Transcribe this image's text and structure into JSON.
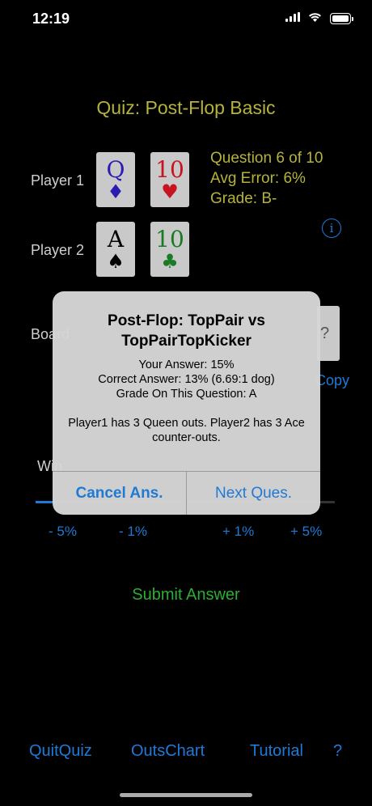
{
  "status_bar": {
    "time": "12:19"
  },
  "title": "Quiz: Post-Flop Basic",
  "players": [
    {
      "label": "Player 1",
      "cards": [
        {
          "rank": "Q",
          "suit": "♦",
          "color": "#2a1bb3"
        },
        {
          "rank": "10",
          "suit": "♥",
          "color": "#c8141e"
        }
      ]
    },
    {
      "label": "Player 2",
      "cards": [
        {
          "rank": "A",
          "suit": "♠",
          "color": "#000000"
        },
        {
          "rank": "10",
          "suit": "♣",
          "color": "#1a7a25"
        }
      ]
    }
  ],
  "info": {
    "question": "Question 6 of 10",
    "avg_error": "Avg Error: 6%",
    "grade": "Grade: B-"
  },
  "info_icon": "i",
  "board": {
    "label": "Board",
    "card_hint": "?",
    "copy_link": "Copy"
  },
  "win_label": "Win",
  "adjust_buttons": [
    "- 5%",
    "- 1%",
    "+ 1%",
    "+ 5%"
  ],
  "submit_label": "Submit Answer",
  "bottom_nav": [
    "QuitQuiz",
    "OutsChart",
    "Tutorial",
    "?"
  ],
  "alert": {
    "title": "Post-Flop: TopPair vs TopPairTopKicker",
    "lines": [
      "Your Answer: 15%",
      "Correct Answer: 13% (6.69:1 dog)",
      "Grade On This Question: A",
      "",
      "Player1 has 3 Queen outs. Player2 has 3 Ace counter-outs."
    ],
    "cancel_label": "Cancel Ans.",
    "next_label": "Next Ques."
  },
  "colors": {
    "accent_blue": "#1f7ad6",
    "title_yellow": "#b5b33a",
    "submit_green": "#2eae32"
  }
}
